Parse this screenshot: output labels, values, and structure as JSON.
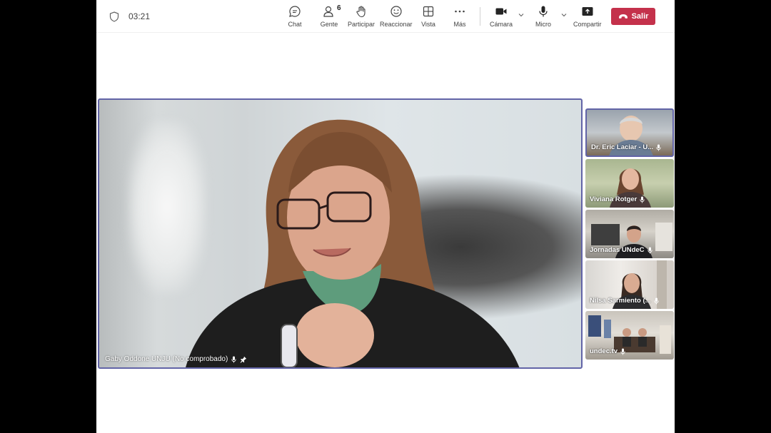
{
  "call": {
    "timer": "03:21"
  },
  "toolbar": {
    "chat": "Chat",
    "people": "Gente",
    "people_count": "6",
    "raise": "Participar",
    "react": "Reaccionar",
    "view": "Vista",
    "more": "Más",
    "camera": "Cámara",
    "mic": "Micro",
    "share": "Compartir",
    "leave": "Salir"
  },
  "main_video": {
    "name": "Gaby Oddone UNJU (No comprobado)"
  },
  "participants": [
    {
      "name": "Dr. Eric Laciar - U..."
    },
    {
      "name": "Viviana Rotger"
    },
    {
      "name": "Jornadas UNdeC"
    },
    {
      "name": "Nilsa Sarmiento (..."
    },
    {
      "name": "undec.tv"
    }
  ],
  "colors": {
    "accent": "#6264a7",
    "leave": "#c4314b"
  }
}
